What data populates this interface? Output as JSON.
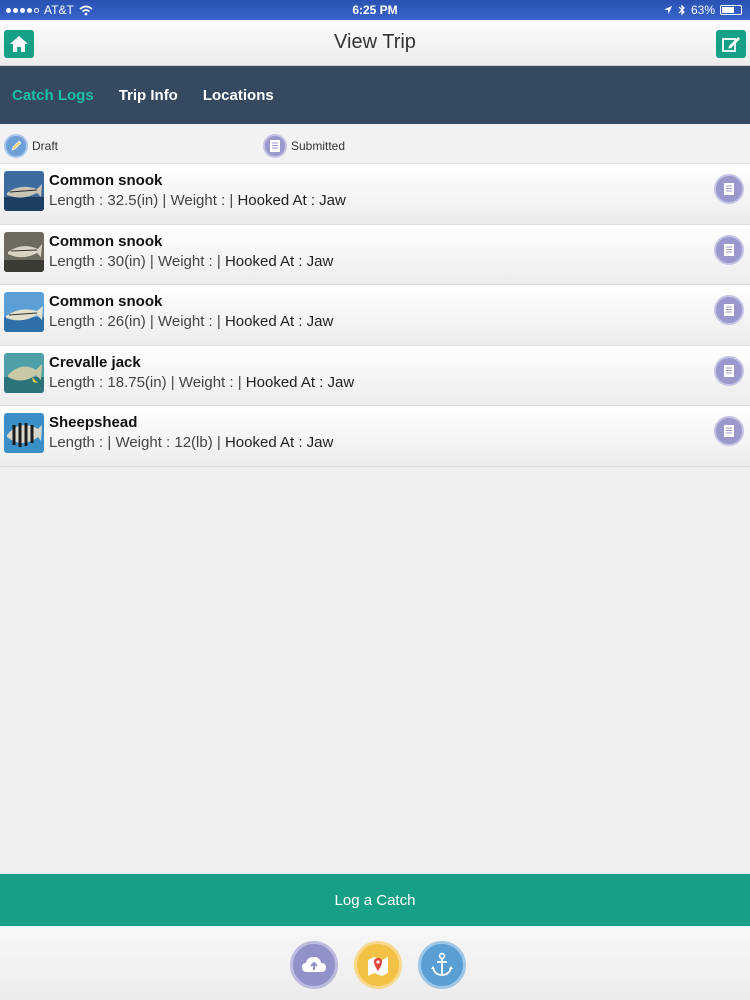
{
  "status_bar": {
    "carrier": "AT&T",
    "time": "6:25 PM",
    "battery": "63%"
  },
  "header": {
    "title": "View Trip"
  },
  "tabs": [
    {
      "label": "Catch Logs",
      "active": true
    },
    {
      "label": "Trip Info",
      "active": false
    },
    {
      "label": "Locations",
      "active": false
    }
  ],
  "legend": {
    "draft": "Draft",
    "submitted": "Submitted"
  },
  "catches": [
    {
      "name": "Common snook",
      "detail_prefix": "Length : 32.5(in) | Weight : | ",
      "detail_hooked": "Hooked At : Jaw",
      "status": "submitted"
    },
    {
      "name": "Common snook",
      "detail_prefix": "Length : 30(in) | Weight : | ",
      "detail_hooked": "Hooked At : Jaw",
      "status": "submitted"
    },
    {
      "name": "Common snook",
      "detail_prefix": "Length : 26(in) | Weight : | ",
      "detail_hooked": "Hooked At : Jaw",
      "status": "submitted"
    },
    {
      "name": "Crevalle jack",
      "detail_prefix": "Length : 18.75(in) | Weight : | ",
      "detail_hooked": "Hooked At : Jaw",
      "status": "submitted"
    },
    {
      "name": "Sheepshead",
      "detail_prefix": "Length : | Weight : 12(lb) | ",
      "detail_hooked": "Hooked At : Jaw",
      "status": "submitted"
    }
  ],
  "actions": {
    "log_catch": "Log a Catch"
  },
  "bottom_icons": [
    "cloud-upload-icon",
    "map-pin-icon",
    "anchor-icon"
  ],
  "colors": {
    "accent": "#18a086",
    "tab_bar": "#354a60",
    "active_tab": "#17c1a3"
  }
}
